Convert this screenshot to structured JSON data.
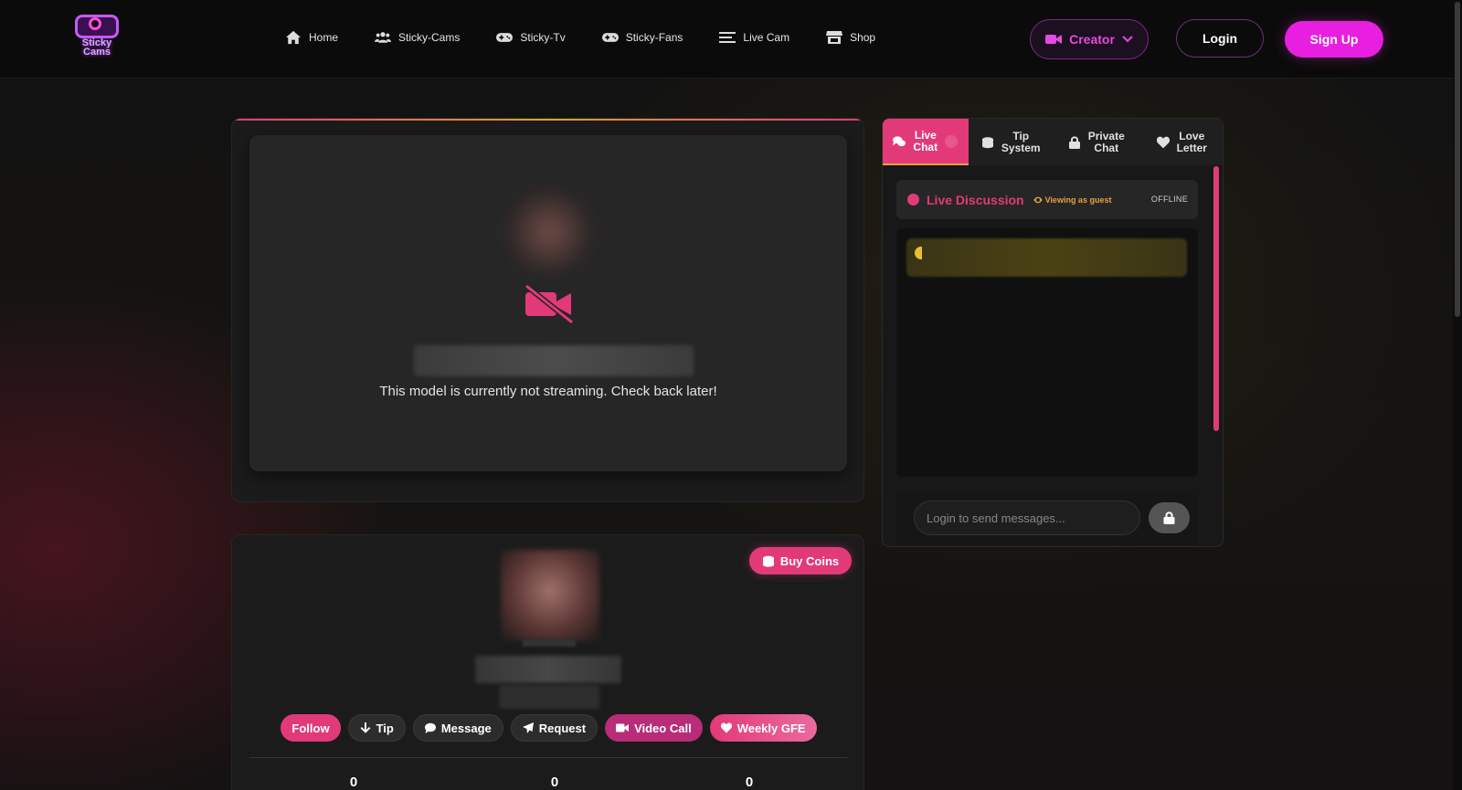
{
  "logo": {
    "line1": "Sticky",
    "line2": "Cams"
  },
  "nav": [
    {
      "label": "Home",
      "icon": "home-icon"
    },
    {
      "label": "Sticky-Cams",
      "icon": "users-icon"
    },
    {
      "label": "Sticky-Tv",
      "icon": "gamepad-icon"
    },
    {
      "label": "Sticky-Fans",
      "icon": "gamepad-icon"
    },
    {
      "label": "Live Cam",
      "icon": "menu-icon"
    },
    {
      "label": "Shop",
      "icon": "store-icon"
    }
  ],
  "header": {
    "creator": "Creator",
    "login": "Login",
    "signup": "Sign Up"
  },
  "video": {
    "message": "This model is currently not streaming. Check back later!"
  },
  "profile": {
    "buy_coins": "Buy Coins",
    "actions": {
      "follow": "Follow",
      "tip": "Tip",
      "message": "Message",
      "request": "Request",
      "video_call": "Video Call",
      "weekly_gfe": "Weekly GFE"
    },
    "stats": [
      "0",
      "0",
      "0"
    ]
  },
  "chat": {
    "tabs": [
      {
        "line1": "Live",
        "line2": "Chat"
      },
      {
        "line1": "Tip",
        "line2": "System"
      },
      {
        "line1": "Private",
        "line2": "Chat"
      },
      {
        "line1": "Love",
        "line2": "Letter"
      }
    ],
    "title": "Live Discussion",
    "guest_label": "Viewing as guest",
    "status": "OFFLINE",
    "input_placeholder": "Login to send messages..."
  },
  "colors": {
    "accent_pink": "#e23a78",
    "brand_magenta": "#e81ee0",
    "warning_amber": "#e8a040"
  }
}
